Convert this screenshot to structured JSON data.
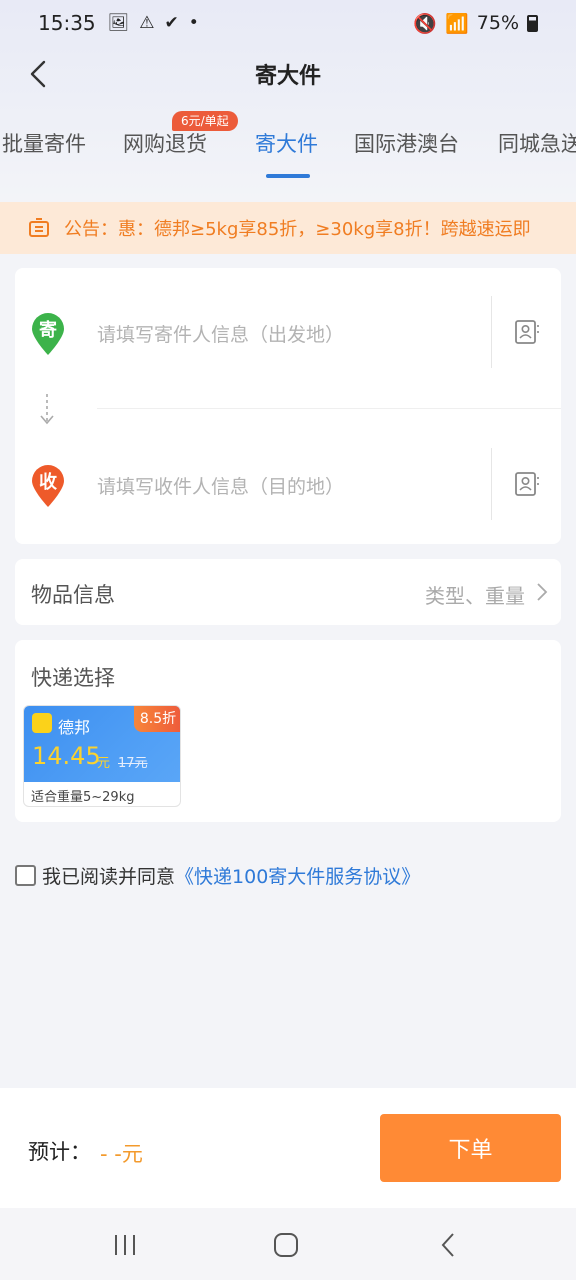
{
  "status_bar": {
    "time": "15:35",
    "battery": "75%"
  },
  "header": {
    "title": "寄大件"
  },
  "tabs": [
    {
      "label": "批量寄件"
    },
    {
      "label": "网购退货"
    },
    {
      "label": "寄大件"
    },
    {
      "label": "国际港澳台"
    },
    {
      "label": "同城急送"
    }
  ],
  "tab_badge": "6元/单起",
  "active_tab": "寄大件",
  "notice": {
    "label": "公告：",
    "text": "惠：德邦≥5kg享85折，≥30kg享8折！跨越速运即"
  },
  "address": {
    "sender_pin": "寄",
    "sender_placeholder": "请填写寄件人信息（出发地）",
    "receiver_pin": "收",
    "receiver_placeholder": "请填写收件人信息（目的地）"
  },
  "item_info": {
    "label": "物品信息",
    "hint": "类型、重量"
  },
  "courier": {
    "title": "快递选择",
    "options": [
      {
        "name": "德邦",
        "discount": "8.5折",
        "price": "14.45",
        "unit": "元",
        "original_price": "17元",
        "weight_range": "适合重量5~29kg"
      }
    ]
  },
  "agreement": {
    "text": "我已阅读并同意",
    "link": "《快递100寄大件服务协议》"
  },
  "bottom": {
    "estimate_label": "预计：",
    "estimate_value": "- -元",
    "order_button": "下单"
  },
  "colors": {
    "accent_blue": "#2f7ad8",
    "accent_orange": "#ff8a35",
    "sender_pin": "#3cb34a",
    "receiver_pin": "#ee5a2a"
  }
}
